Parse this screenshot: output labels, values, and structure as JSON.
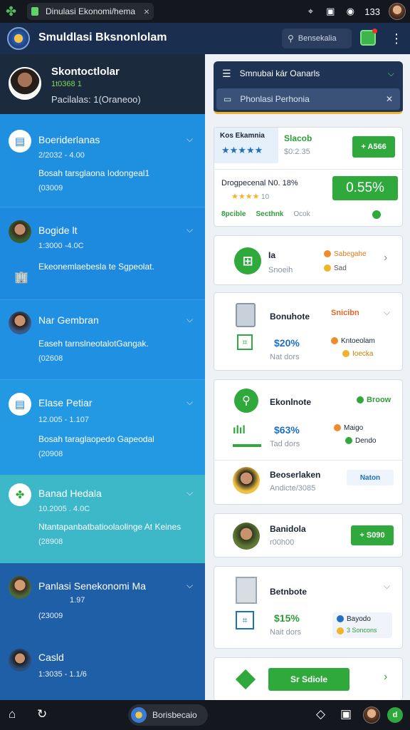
{
  "browser": {
    "tab_title": "Dinulasi Ekonomi/hema",
    "tab_close": "×",
    "time": "133"
  },
  "app": {
    "title": "Smuldlasi Bksnonlolam",
    "search_placeholder": "Bensekalia"
  },
  "profile": {
    "name": "Skontoctlolar",
    "id": "1t0368 1",
    "balance": "Pacilalas: 1(Oraneoo)"
  },
  "left_items": [
    {
      "title": "Boeriderlanas",
      "sub": "2/2032 -  4.00",
      "desc": "Bosah tarsglaona Iodongeal1",
      "code": "(03009"
    },
    {
      "title": "Bogide  lt",
      "sub": "1:3000  -4.0C",
      "desc": "Ekeonemlaebesla te Sgpeolat.",
      "code": ""
    },
    {
      "title": "Nar Gembran",
      "sub": "",
      "desc": "Easeh tarnslneotalotGangak.",
      "code": "(02608"
    },
    {
      "title": "Elase Petiar",
      "sub": "12.005  -  1.107",
      "desc": "Bosah taraglaopedo Gapeodal",
      "code": "(20908"
    },
    {
      "title": "Banad Hedala",
      "sub": "10.2005  .  4.0C",
      "desc": "Ntantapanbatbatioolaolinge At Keines",
      "code": "(28908"
    },
    {
      "title": "Panlasi Senekonomi Ma",
      "sub": "1.97",
      "desc": "",
      "code": "(23009"
    },
    {
      "title": "Casld",
      "sub": "1:3035  -  1.1/6",
      "desc": "",
      "code": ""
    }
  ],
  "nav": {
    "row1": "Smnubai kár Oanarls",
    "row2": "Phonlasi Perhonia"
  },
  "card1": {
    "badge": "Kos Ekamnia",
    "stars": "★★★★★",
    "name": "Slacob",
    "price": "$0:2.35",
    "button": "+ A566",
    "row_label": "Drogpecenal  N0. 18%",
    "row_stars": "★★★★",
    "row_count": "10",
    "percent": "0.55%",
    "f1": "8pcible",
    "f2": "Secthnk",
    "f3": "Ocok"
  },
  "card2": {
    "title": "Ia",
    "sub": "Snoeih",
    "t1": "Sabegahe",
    "t2": "Sad"
  },
  "card3": {
    "title": "Bonuhote",
    "tag": "Snicibn",
    "price": "$20%",
    "sub": "Nat dors",
    "t1": "Kntoeolam",
    "t2": "Ioecka"
  },
  "card4": {
    "title": "Ekonlnote",
    "tag": "Broow",
    "price": "$63%",
    "sub": "Tad dors",
    "t1": "Maigo",
    "t2": "Dendo",
    "note": "Beoserlaken",
    "note_sub": "Andicte/3085",
    "tag2": "Naton"
  },
  "card5": {
    "title": "Banidola",
    "sub": "r00h00",
    "button": "+ S090"
  },
  "card6": {
    "title": "Betnbote",
    "price": "$15%",
    "sub": "Nait dors",
    "t1": "Bayodo",
    "t2": "3 Soncons"
  },
  "card7": {
    "button": "Sr  Sdiole"
  },
  "bottom": {
    "pill": "Borisbecaio"
  },
  "colors": {
    "accent": "#2fa83c",
    "sidebar": "#1f8fe0",
    "topbar": "#1a2f4f"
  }
}
